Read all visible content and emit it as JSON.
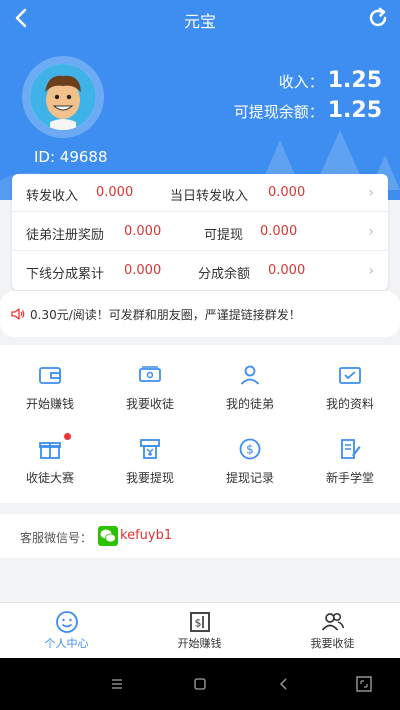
{
  "header": {
    "title": "元宝",
    "user_id": "ID: 49688",
    "income_label": "收入：",
    "income_value": "1.25",
    "balance_label": "可提现余额：",
    "balance_value": "1.25",
    "accent_color": "#3d8ef0"
  },
  "stats": [
    [
      {
        "label": "转发收入",
        "value": "0.000"
      },
      {
        "label": "当日转发收入",
        "value": "0.000"
      }
    ],
    [
      {
        "label": "徒弟注册奖励",
        "value": "0.000"
      },
      {
        "label": "可提现",
        "value": "0.000"
      }
    ],
    [
      {
        "label": "下线分成累计",
        "value": "0.000"
      },
      {
        "label": "分成余额",
        "value": "0.000"
      }
    ]
  ],
  "notice": {
    "text": "0.30元/阅读！可发群和朋友圈，严谨提链接群发！",
    "icon": "speaker-icon"
  },
  "menu": [
    {
      "label": "开始赚钱",
      "icon": "wallet-icon"
    },
    {
      "label": "我要收徒",
      "icon": "money-icon"
    },
    {
      "label": "我的徒弟",
      "icon": "person-icon"
    },
    {
      "label": "我的资料",
      "icon": "id-card-icon"
    },
    {
      "label": "收徒大赛",
      "icon": "gift-icon"
    },
    {
      "label": "我要提现",
      "icon": "atm-icon"
    },
    {
      "label": "提现记录",
      "icon": "dollar-coin-icon"
    },
    {
      "label": "新手学堂",
      "icon": "document-edit-icon"
    }
  ],
  "service": {
    "label": "客服微信号：",
    "wechat_id": "kefuyb1"
  },
  "tabs": [
    {
      "label": "个人中心",
      "icon": "smiley-icon",
      "active": true
    },
    {
      "label": "开始赚钱",
      "icon": "dollar-doc-icon",
      "active": false
    },
    {
      "label": "我要收徒",
      "icon": "people-icon",
      "active": false
    }
  ]
}
